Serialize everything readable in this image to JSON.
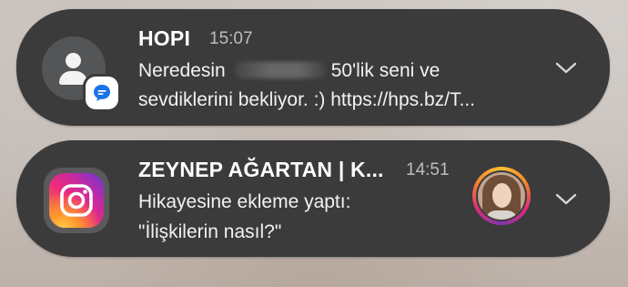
{
  "notifications": [
    {
      "app": "Messages",
      "title": "HOPI",
      "time": "15:07",
      "line1_before": "Neredesin",
      "line1_after": "50'lik seni ve",
      "line2": "sevdiklerini bekliyor. :) https://hps.bz/T...",
      "icon": "person-icon",
      "badge_icon": "chat-bubble-icon"
    },
    {
      "app": "Instagram",
      "title": "ZEYNEP AĞ̆ARTAN | K...",
      "time": "14:51",
      "line1": "Hikayesine ekleme yaptı:",
      "line2": "\"İlişkilerin nasıl?\"",
      "icon": "instagram-icon",
      "avatar": "profile-photo"
    }
  ],
  "colors": {
    "card_bg": "#3b3b3c",
    "text": "#ffffff",
    "time_text": "#bdbdbd",
    "messages_badge_blue": "#1a73e8"
  }
}
